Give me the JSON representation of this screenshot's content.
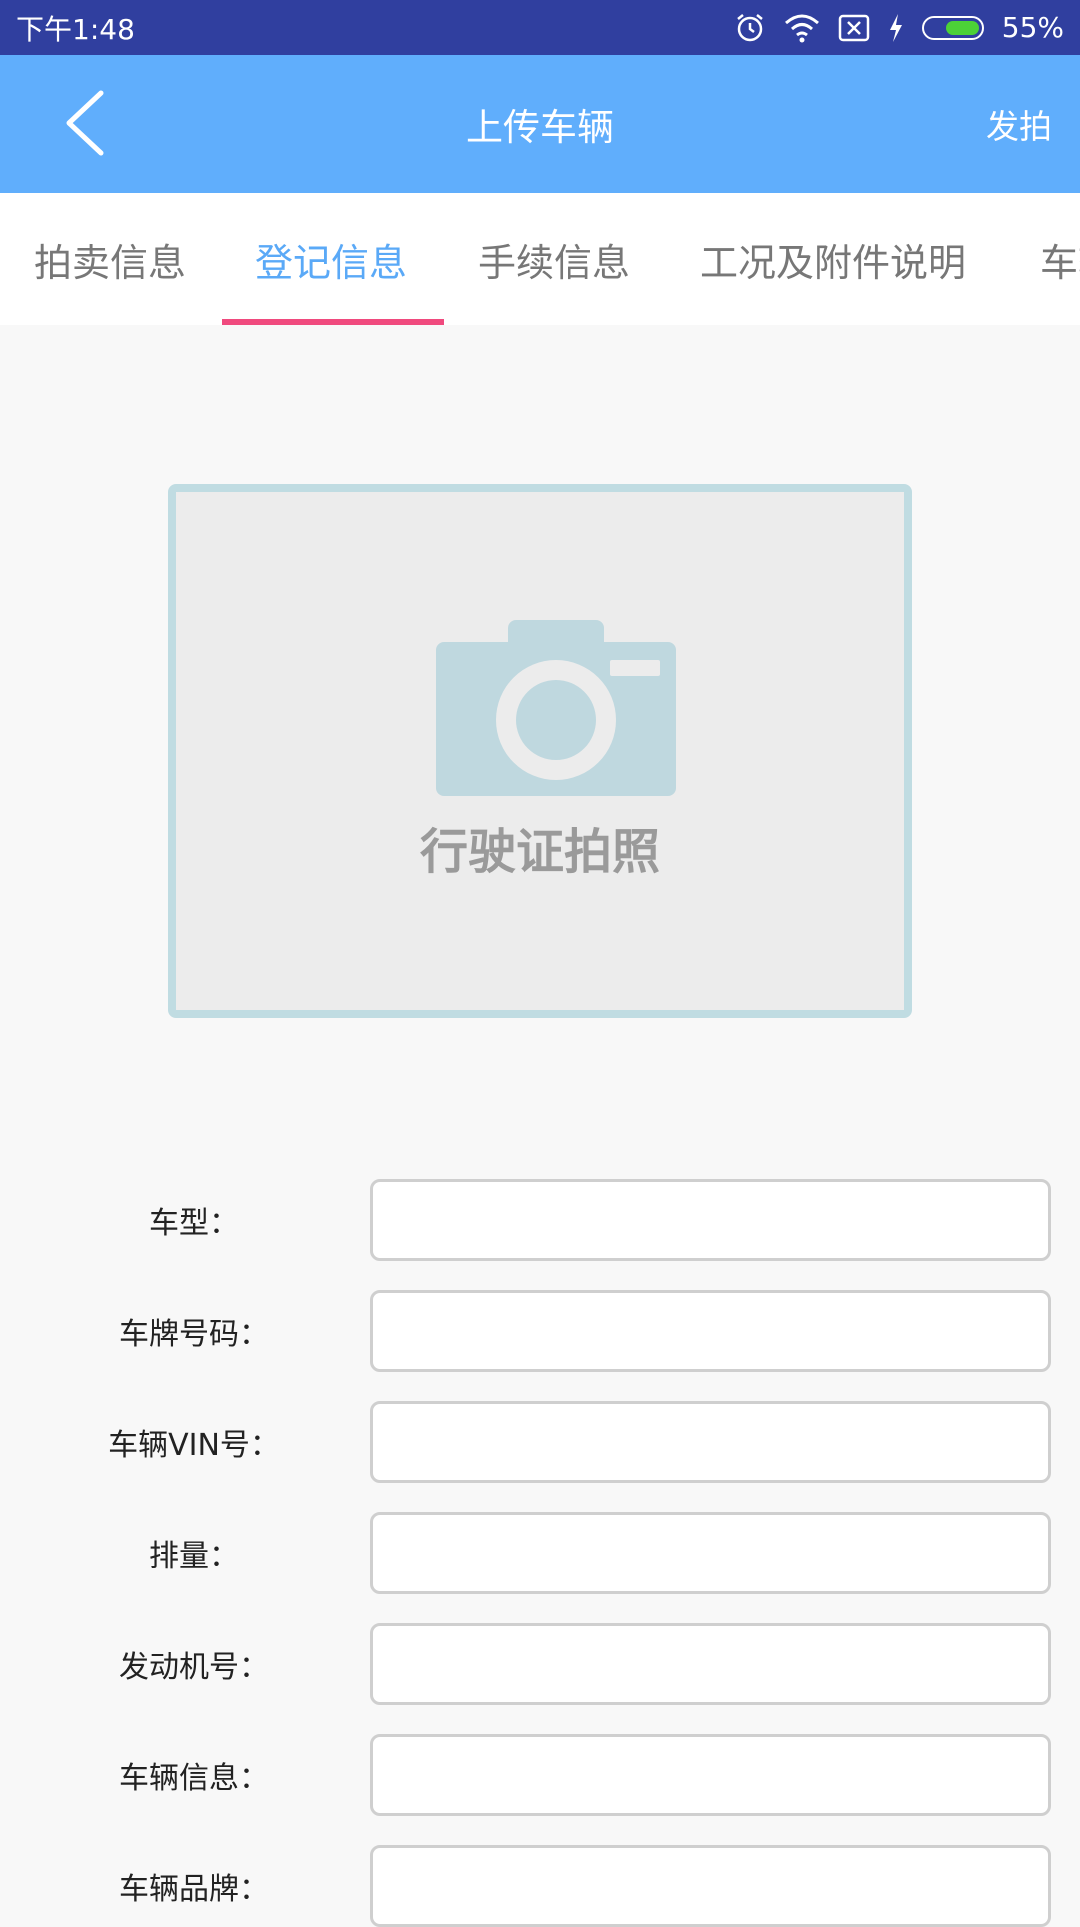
{
  "status_bar": {
    "time": "下午1:48",
    "battery_percent": "55%",
    "icons": [
      "alarm-icon",
      "wifi-icon",
      "no-sim-icon",
      "charging-icon",
      "battery-icon"
    ],
    "battery_level": 0.55
  },
  "app_bar": {
    "title": "上传车辆",
    "action_label": "发拍",
    "back_icon": "chevron-left-icon"
  },
  "tabs": {
    "items": [
      {
        "label": "拍卖信息"
      },
      {
        "label": "登记信息"
      },
      {
        "label": "手续信息"
      },
      {
        "label": "工况及附件说明"
      },
      {
        "label": "车辆"
      }
    ],
    "active_index": 1
  },
  "photo": {
    "label": "行驶证拍照",
    "icon": "camera-icon"
  },
  "form": {
    "fields": [
      {
        "label": "车型：",
        "value": ""
      },
      {
        "label": "车牌号码：",
        "value": ""
      },
      {
        "label": "车辆VIN号：",
        "value": ""
      },
      {
        "label": "排量：",
        "value": ""
      },
      {
        "label": "发动机号：",
        "value": ""
      },
      {
        "label": "车辆信息：",
        "value": ""
      },
      {
        "label": "车辆品牌：",
        "value": ""
      }
    ]
  },
  "colors": {
    "status_bar": "#303f9f",
    "app_bar": "#60aefc",
    "tab_active": "#5aa9f7",
    "tab_indicator": "#f04a7e",
    "photo_border": "#c0dce2",
    "camera": "#bfd8df"
  }
}
